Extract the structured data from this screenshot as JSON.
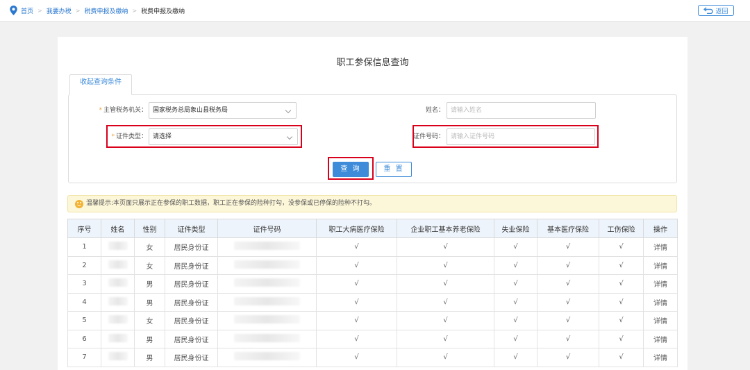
{
  "breadcrumb": {
    "items": [
      {
        "label": "首页"
      },
      {
        "label": "我要办税"
      },
      {
        "label": "税费申报及缴纳"
      },
      {
        "label": "税费申报及缴纳"
      }
    ],
    "separator": ">"
  },
  "back_button": {
    "label": "返回"
  },
  "page_title": "职工参保信息查询",
  "tab": {
    "label": "收起查询条件"
  },
  "form": {
    "tax_authority": {
      "required_mark": "*",
      "label": "主管税务机关：",
      "value": "国家税务总局象山县税务局"
    },
    "name": {
      "label": "姓名：",
      "placeholder": "请输入姓名"
    },
    "id_type": {
      "required_mark": "*",
      "label": "证件类型：",
      "value": "请选择"
    },
    "id_number": {
      "label": "证件号码：",
      "placeholder": "请输入证件号码"
    }
  },
  "buttons": {
    "query": "查 询",
    "reset": "重 置"
  },
  "tip": "温馨提示:本页面只展示正在参保的职工数据，职工正在参保的险种打勾，没参保或已停保的险种不打勾。",
  "table": {
    "headers": [
      "序号",
      "姓名",
      "性别",
      "证件类型",
      "证件号码",
      "职工大病医疗保险",
      "企业职工基本养老保险",
      "失业保险",
      "基本医疗保险",
      "工伤保险",
      "操作"
    ],
    "rows": [
      {
        "no": "1",
        "name": "",
        "gender": "女",
        "id_type": "居民身份证",
        "id_number": "",
        "c1": "√",
        "c2": "√",
        "c3": "√",
        "c4": "√",
        "c5": "√",
        "action": "详情"
      },
      {
        "no": "2",
        "name": "",
        "gender": "女",
        "id_type": "居民身份证",
        "id_number": "",
        "c1": "√",
        "c2": "√",
        "c3": "√",
        "c4": "√",
        "c5": "√",
        "action": "详情"
      },
      {
        "no": "3",
        "name": "",
        "gender": "男",
        "id_type": "居民身份证",
        "id_number": "",
        "c1": "√",
        "c2": "√",
        "c3": "√",
        "c4": "√",
        "c5": "√",
        "action": "详情"
      },
      {
        "no": "4",
        "name": "",
        "gender": "男",
        "id_type": "居民身份证",
        "id_number": "",
        "c1": "√",
        "c2": "√",
        "c3": "√",
        "c4": "√",
        "c5": "√",
        "action": "详情"
      },
      {
        "no": "5",
        "name": "",
        "gender": "女",
        "id_type": "居民身份证",
        "id_number": "",
        "c1": "√",
        "c2": "√",
        "c3": "√",
        "c4": "√",
        "c5": "√",
        "action": "详情"
      },
      {
        "no": "6",
        "name": "",
        "gender": "男",
        "id_type": "居民身份证",
        "id_number": "",
        "c1": "√",
        "c2": "√",
        "c3": "√",
        "c4": "√",
        "c5": "√",
        "action": "详情"
      },
      {
        "no": "7",
        "name": "",
        "gender": "男",
        "id_type": "居民身份证",
        "id_number": "",
        "c1": "√",
        "c2": "√",
        "c3": "√",
        "c4": "√",
        "c5": "√",
        "action": "详情"
      }
    ]
  },
  "colors": {
    "accent": "#3d8bd9",
    "highlight": "#d9001b",
    "tip_bg": "#fdf7d9",
    "required": "#e8a33d"
  }
}
